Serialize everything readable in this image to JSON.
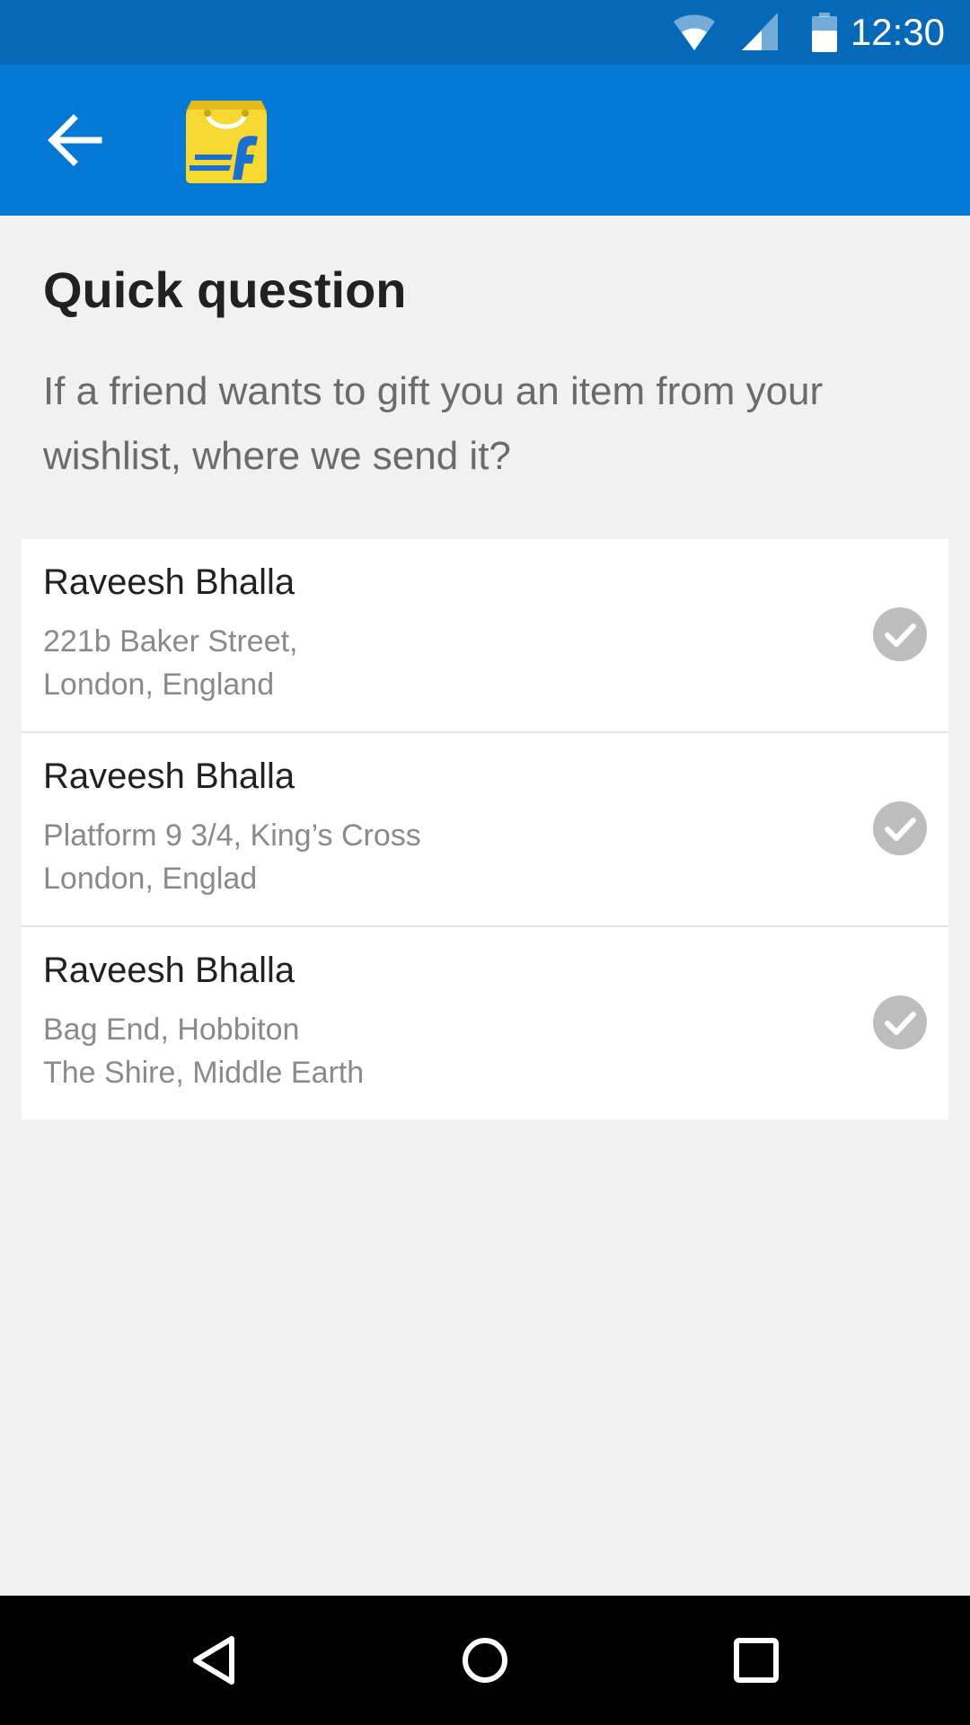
{
  "status_bar": {
    "time": "12:30",
    "icons": [
      "wifi-icon",
      "signal-icon",
      "battery-icon"
    ]
  },
  "app_bar": {
    "back_icon": "arrow-left-icon",
    "logo": "flipkart-shopping-bag-logo",
    "logo_letter": "f"
  },
  "main": {
    "title": "Quick question",
    "question": "If a friend wants to gift you an item from your wishlist, where we send it?"
  },
  "addresses": [
    {
      "name": "Raveesh Bhalla",
      "line1": "221b Baker Street,",
      "line2": "London, England"
    },
    {
      "name": "Raveesh Bhalla",
      "line1": "Platform 9 3/4, King’s Cross",
      "line2": "London, Englad"
    },
    {
      "name": "Raveesh Bhalla",
      "line1": "Bag End, Hobbiton",
      "line2": "The Shire, Middle Earth"
    }
  ],
  "nav_bar": {
    "icons": [
      "nav-back-icon",
      "nav-home-icon",
      "nav-recents-icon"
    ]
  },
  "colors": {
    "status_bar": "#0569b7",
    "app_bar": "#0478d2",
    "background": "#f1f1f1",
    "card": "#ffffff",
    "check_circle": "#bdbdbd",
    "logo_yellow": "#f7d832",
    "logo_blue": "#1a6fd0"
  }
}
